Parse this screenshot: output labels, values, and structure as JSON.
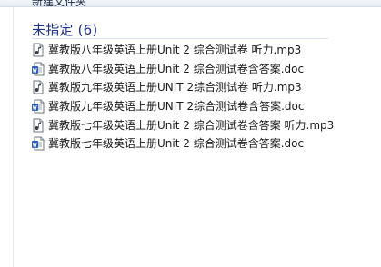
{
  "toolbar": {
    "partial_text": "新建文件夹"
  },
  "group": {
    "label": "未指定 (6)"
  },
  "files": [
    {
      "name": "冀教版八年级英语上册Unit 2 综合测试卷 听力.mp3",
      "type": "mp3",
      "icon": "audio-file-icon"
    },
    {
      "name": "冀教版八年级英语上册Unit 2 综合测试卷含答案.doc",
      "type": "doc",
      "icon": "word-document-icon"
    },
    {
      "name": "冀教版九年级英语上册UNIT 2综合测试卷 听力.mp3",
      "type": "mp3",
      "icon": "audio-file-icon"
    },
    {
      "name": "冀教版九年级英语上册UNIT 2综合测试卷含答案.doc",
      "type": "doc",
      "icon": "word-document-icon"
    },
    {
      "name": "冀教版七年级英语上册Unit 2 综合测试卷含答案 听力.mp3",
      "type": "mp3",
      "icon": "audio-file-icon"
    },
    {
      "name": "冀教版七年级英语上册Unit 2 综合测试卷含答案.doc",
      "type": "doc",
      "icon": "word-document-icon"
    }
  ],
  "colors": {
    "group_label": "#1e3287",
    "doc_icon": "#2b5eb8",
    "mp3_icon": "#3a3f4a"
  }
}
